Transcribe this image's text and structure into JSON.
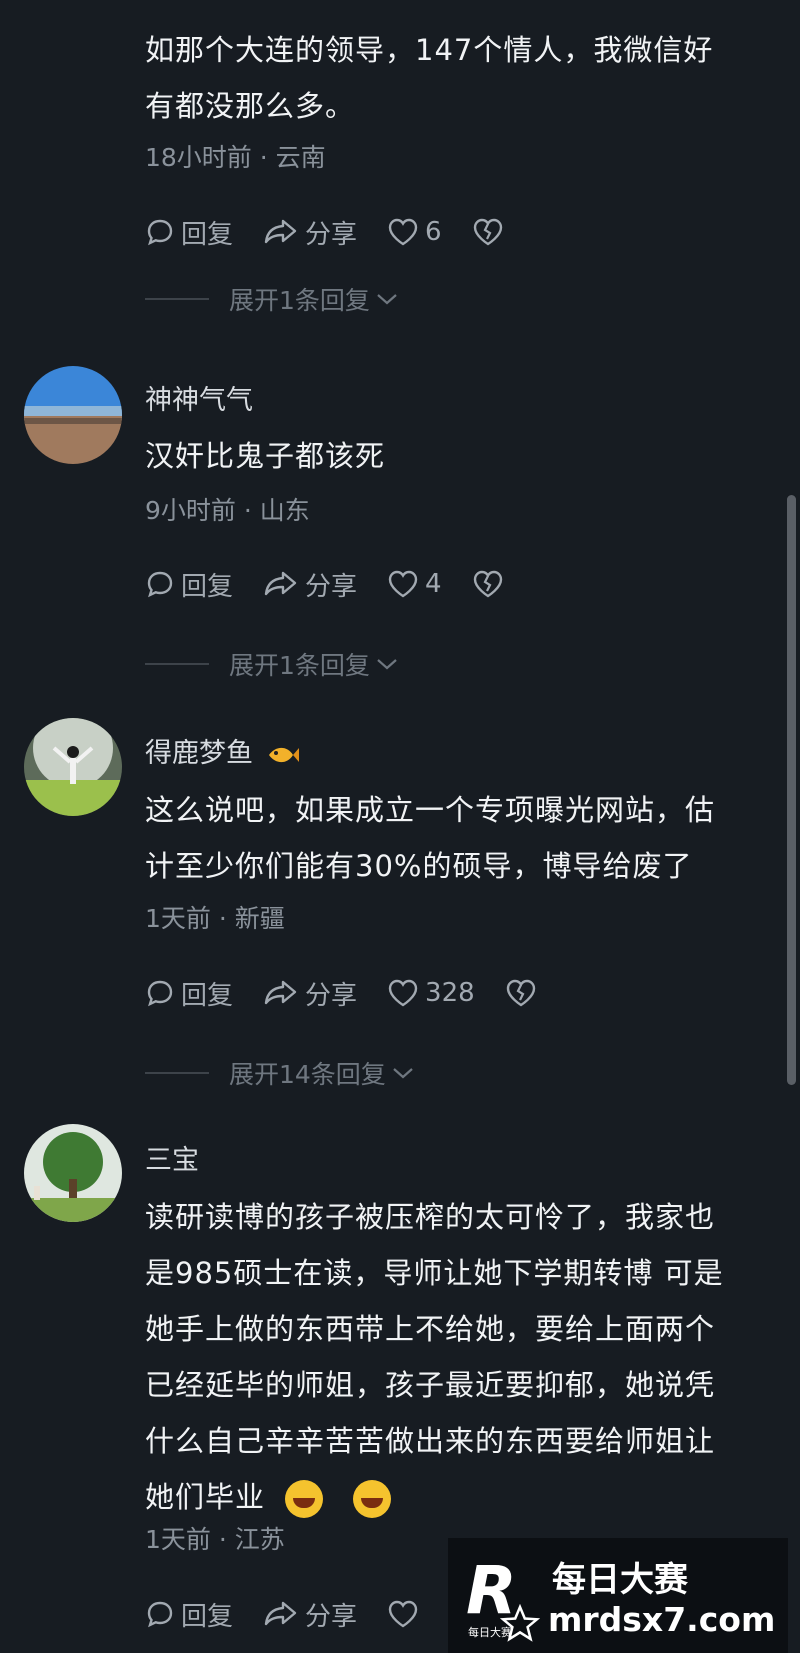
{
  "comments": [
    {
      "text_lines": [
        "如那个大连的领导，147个情人，我微信好",
        "有都没那么多。"
      ],
      "meta": "18小时前 · 云南",
      "reply_label": "回复",
      "share_label": "分享",
      "likes": "6",
      "expand": "展开1条回复"
    },
    {
      "author": "神神气气",
      "text_lines": [
        "汉奸比鬼子都该死"
      ],
      "meta": "9小时前 · 山东",
      "reply_label": "回复",
      "share_label": "分享",
      "likes": "4",
      "expand": "展开1条回复"
    },
    {
      "author": "得鹿梦鱼",
      "text_lines": [
        "这么说吧，如果成立一个专项曝光网站，估",
        "计至少你们能有30%的硕导，博导给废了"
      ],
      "meta": "1天前 · 新疆",
      "reply_label": "回复",
      "share_label": "分享",
      "likes": "328",
      "expand": "展开14条回复"
    },
    {
      "author": "三宝",
      "text_lines": [
        "读研读博的孩子被压榨的太可怜了，我家也",
        "是985硕士在读，导师让她下学期转博 可是",
        "她手上做的东西带上不给她，要给上面两个",
        "已经延毕的师姐，孩子最近要抑郁，她说凭",
        "什么自己辛辛苦苦做出来的东西要给师姐让",
        "她们毕业"
      ],
      "meta": "1天前 · 江苏",
      "reply_label": "回复",
      "share_label": "分享"
    }
  ],
  "watermark": {
    "logo_letter": "R",
    "name": "每日大赛",
    "url": "mrdsx7.com",
    "small": "每日大赛"
  },
  "icons": {
    "reply": "comment-bubble-icon",
    "share": "share-arrow-icon",
    "like": "heart-icon",
    "dislike": "broken-heart-icon",
    "expand": "chevron-down-icon"
  },
  "colors": {
    "background": "#171c22",
    "text": "#f1f3f5",
    "meta": "#8a929b",
    "action": "#a2a9b1"
  }
}
